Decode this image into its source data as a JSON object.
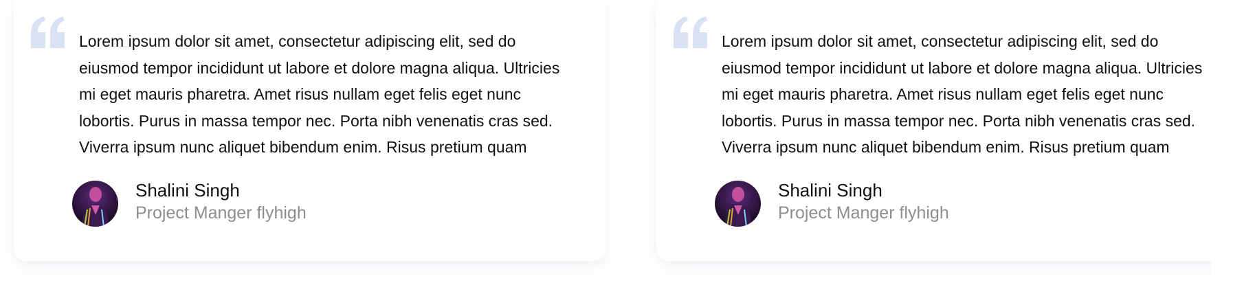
{
  "testimonials": [
    {
      "quote": "Lorem ipsum dolor sit amet, consectetur adipiscing elit, sed do\neiusmod tempor incididunt ut labore et dolore magna aliqua. Ultricies\nmi eget mauris pharetra. Amet risus nullam eget felis eget nunc\nlobortis. Purus in massa tempor nec. Porta nibh venenatis cras sed.\nViverra ipsum nunc aliquet bibendum enim. Risus pretium quam",
      "author_name": "Shalini Singh",
      "author_role": "Project Manger flyhigh"
    },
    {
      "quote": "Lorem ipsum dolor sit amet, consectetur adipiscing elit, sed do\neiusmod tempor incididunt ut labore et dolore magna aliqua. Ultricies\nmi eget mauris pharetra. Amet risus nullam eget felis eget nunc\nlobortis. Purus in massa tempor nec. Porta nibh venenatis cras sed.\nViverra ipsum nunc aliquet bibendum enim. Risus pretium quam",
      "author_name": "Shalini Singh",
      "author_role": "Project Manger flyhigh"
    }
  ],
  "icons": {
    "quote": "quote-icon",
    "avatar": "avatar-photo"
  },
  "colors": {
    "quote_mark": "#d9e1f4",
    "text": "#111111",
    "role_text": "#8e8e8e",
    "card_background": "#ffffff"
  }
}
